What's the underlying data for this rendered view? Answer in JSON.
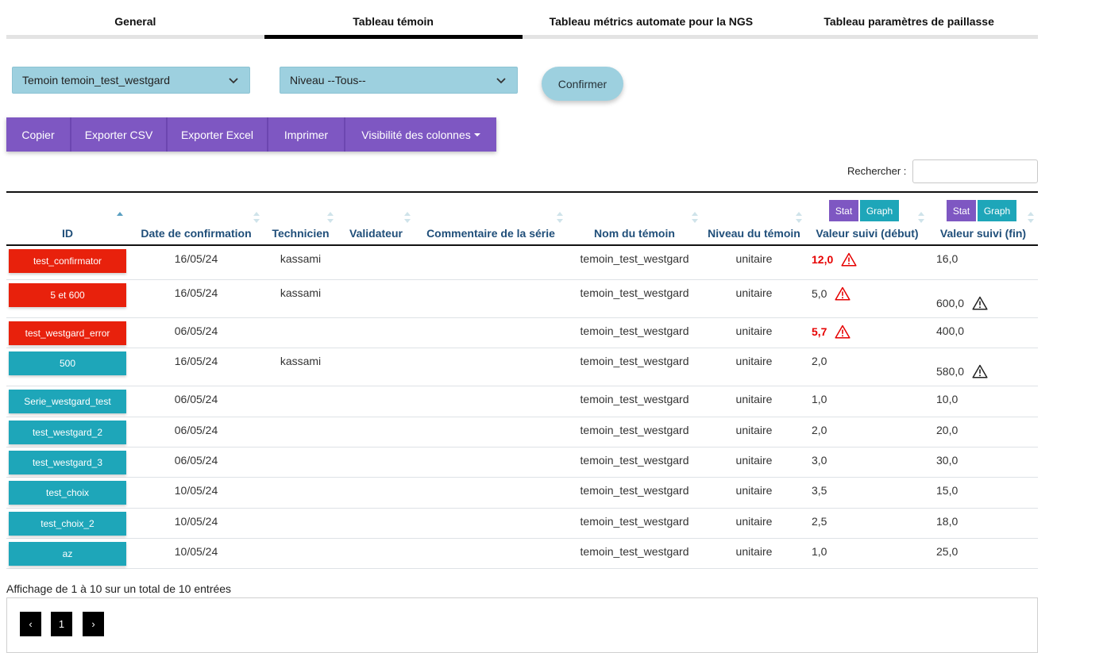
{
  "tabs": [
    {
      "label": "General",
      "active": false
    },
    {
      "label": "Tableau témoin",
      "active": true
    },
    {
      "label": "Tableau métrics automate pour la NGS",
      "active": false
    },
    {
      "label": "Tableau paramètres de paillasse",
      "active": false
    }
  ],
  "filters": {
    "temoin": "Temoin temoin_test_westgard",
    "niveau": "Niveau --Tous--",
    "confirm_label": "Confirmer"
  },
  "toolbar": {
    "copy": "Copier",
    "csv": "Exporter CSV",
    "excel": "Exporter Excel",
    "print": "Imprimer",
    "columns": "Visibilité des colonnes"
  },
  "search": {
    "label": "Rechercher :",
    "value": ""
  },
  "table": {
    "headers": {
      "id": "ID",
      "date": "Date de confirmation",
      "tech": "Technicien",
      "valid": "Validateur",
      "comment": "Commentaire de la série",
      "name": "Nom du témoin",
      "level": "Niveau du témoin",
      "start": "Valeur suivi (début)",
      "end": "Valeur suivi (fin)"
    },
    "stat_label": "Stat",
    "graph_label": "Graph",
    "rows": [
      {
        "id": "test_confirmator",
        "id_color": "red",
        "date": "16/05/24",
        "tech": "kassami",
        "valid": "",
        "comment": "",
        "name": "temoin_test_westgard",
        "level": "unitaire",
        "start": "12,0",
        "start_alert": true,
        "start_warn": true,
        "end": "16,0",
        "end_warn": false
      },
      {
        "id": "5 et 600",
        "id_color": "red",
        "date": "16/05/24",
        "tech": "kassami",
        "valid": "",
        "comment": "",
        "name": "temoin_test_westgard",
        "level": "unitaire",
        "start": "5,0",
        "start_alert": false,
        "start_warn": true,
        "end": "600,0",
        "end_warn": true
      },
      {
        "id": "test_westgard_error",
        "id_color": "red",
        "date": "06/05/24",
        "tech": "",
        "valid": "",
        "comment": "",
        "name": "temoin_test_westgard",
        "level": "unitaire",
        "start": "5,7",
        "start_alert": true,
        "start_warn": true,
        "end": "400,0",
        "end_warn": false
      },
      {
        "id": "500",
        "id_color": "teal",
        "date": "16/05/24",
        "tech": "kassami",
        "valid": "",
        "comment": "",
        "name": "temoin_test_westgard",
        "level": "unitaire",
        "start": "2,0",
        "start_alert": false,
        "start_warn": false,
        "end": "580,0",
        "end_warn": true
      },
      {
        "id": "Serie_westgard_test",
        "id_color": "teal",
        "date": "06/05/24",
        "tech": "",
        "valid": "",
        "comment": "",
        "name": "temoin_test_westgard",
        "level": "unitaire",
        "start": "1,0",
        "start_alert": false,
        "start_warn": false,
        "end": "10,0",
        "end_warn": false
      },
      {
        "id": "test_westgard_2",
        "id_color": "teal",
        "date": "06/05/24",
        "tech": "",
        "valid": "",
        "comment": "",
        "name": "temoin_test_westgard",
        "level": "unitaire",
        "start": "2,0",
        "start_alert": false,
        "start_warn": false,
        "end": "20,0",
        "end_warn": false
      },
      {
        "id": "test_westgard_3",
        "id_color": "teal",
        "date": "06/05/24",
        "tech": "",
        "valid": "",
        "comment": "",
        "name": "temoin_test_westgard",
        "level": "unitaire",
        "start": "3,0",
        "start_alert": false,
        "start_warn": false,
        "end": "30,0",
        "end_warn": false
      },
      {
        "id": "test_choix",
        "id_color": "teal",
        "date": "10/05/24",
        "tech": "",
        "valid": "",
        "comment": "",
        "name": "temoin_test_westgard",
        "level": "unitaire",
        "start": "3,5",
        "start_alert": false,
        "start_warn": false,
        "end": "15,0",
        "end_warn": false
      },
      {
        "id": "test_choix_2",
        "id_color": "teal",
        "date": "10/05/24",
        "tech": "",
        "valid": "",
        "comment": "",
        "name": "temoin_test_westgard",
        "level": "unitaire",
        "start": "2,5",
        "start_alert": false,
        "start_warn": false,
        "end": "18,0",
        "end_warn": false
      },
      {
        "id": "az",
        "id_color": "teal",
        "date": "10/05/24",
        "tech": "",
        "valid": "",
        "comment": "",
        "name": "temoin_test_westgard",
        "level": "unitaire",
        "start": "1,0",
        "start_alert": false,
        "start_warn": false,
        "end": "25,0",
        "end_warn": false
      }
    ]
  },
  "footer": {
    "info": "Affichage de 1 à 10 sur un total de 10 entrées",
    "prev": "‹",
    "page": "1",
    "next": "›"
  },
  "colors": {
    "accent_purple": "#7e57c2",
    "accent_teal": "#1ea6b9",
    "select_blue": "#9dd0df",
    "alert_red": "#e8210c"
  },
  "icons": {
    "warning": "warning-triangle-icon",
    "chevron": "chevron-down-icon",
    "sort": "sort-arrows-icon"
  }
}
